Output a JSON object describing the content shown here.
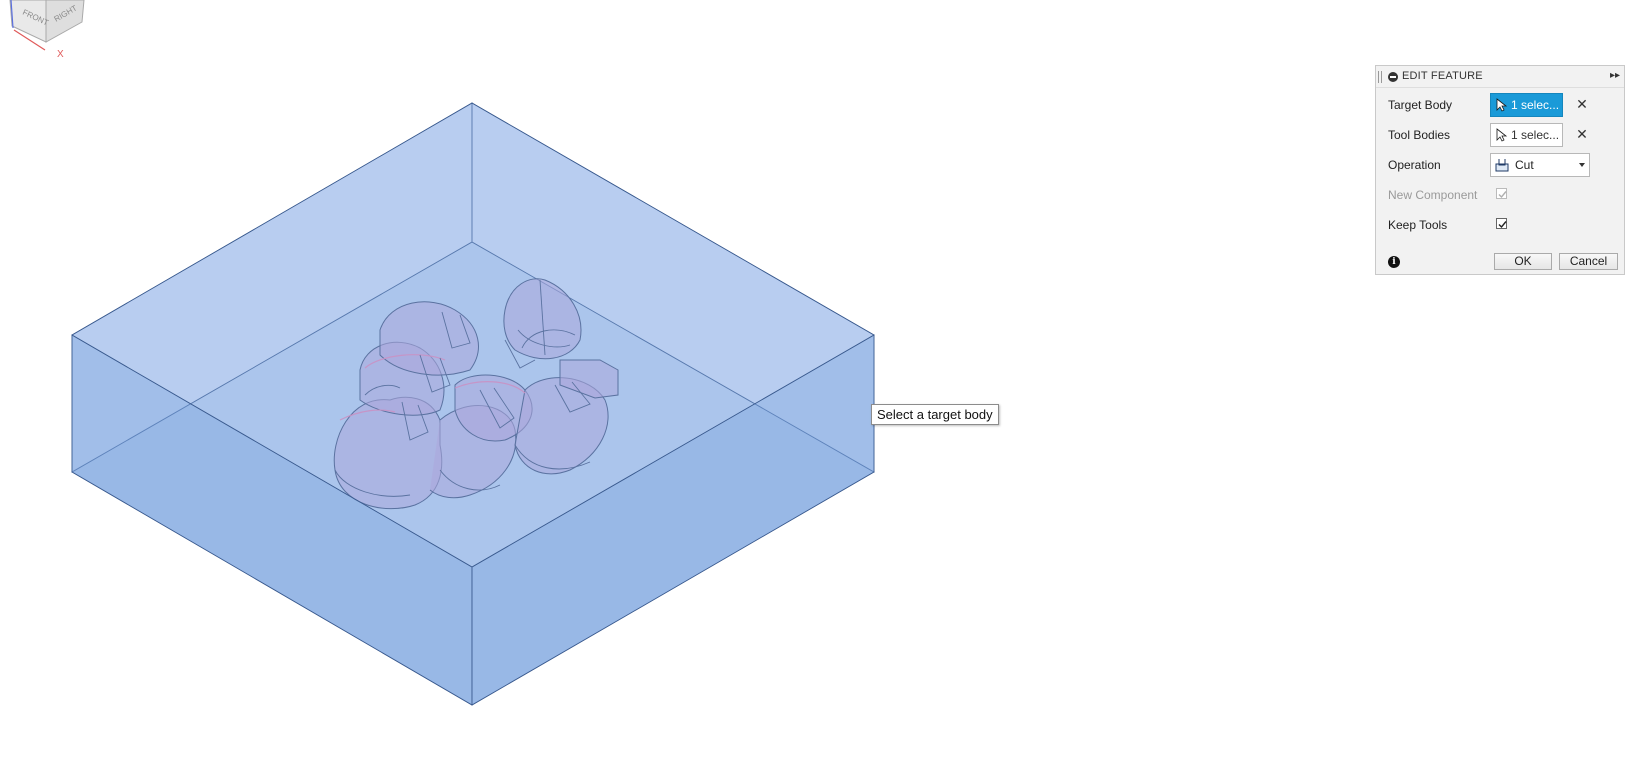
{
  "viewport": {
    "tooltip": "Select a target body",
    "view_cube": {
      "front_label": "FRONT",
      "right_label": "RIGHT",
      "axis_label": "X"
    },
    "colors": {
      "box_fill": "#7ea6e0",
      "box_edge": "#3b5b8f",
      "tool_fill": "#b9a0d6",
      "highlight": "#e77fb0"
    }
  },
  "panel": {
    "title": "EDIT FEATURE",
    "rows": {
      "target_body": {
        "label": "Target Body",
        "value": "1 selec..."
      },
      "tool_bodies": {
        "label": "Tool Bodies",
        "value": "1 selec..."
      },
      "operation": {
        "label": "Operation",
        "value": "Cut"
      },
      "new_component": {
        "label": "New Component",
        "checked": true,
        "disabled": true
      },
      "keep_tools": {
        "label": "Keep Tools",
        "checked": true
      }
    },
    "buttons": {
      "ok": "OK",
      "cancel": "Cancel"
    },
    "accent": "#1a9ad8"
  }
}
